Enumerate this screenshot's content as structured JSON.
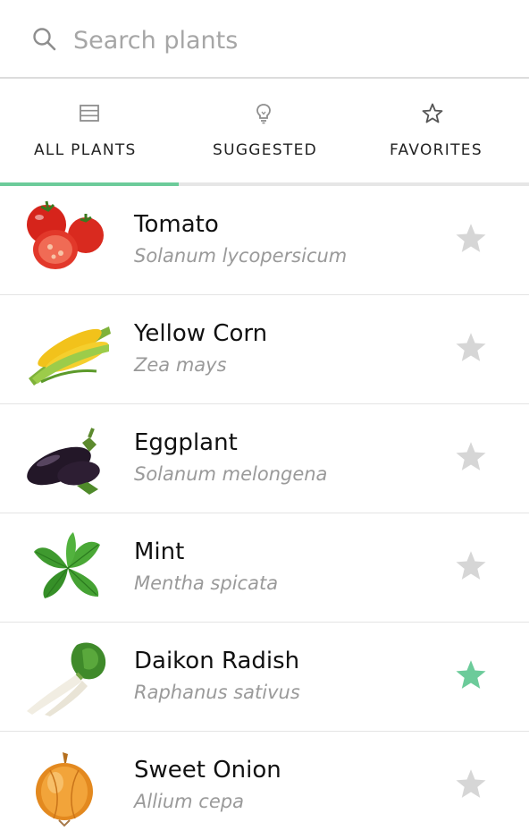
{
  "search": {
    "placeholder": "Search plants",
    "icon": "search-icon"
  },
  "tabs": [
    {
      "label": "ALL PLANTS",
      "icon": "list-icon",
      "active": true
    },
    {
      "label": "SUGGESTED",
      "icon": "lightbulb-icon",
      "active": false
    },
    {
      "label": "FAVORITES",
      "icon": "star-outline-icon",
      "active": false
    }
  ],
  "plants": [
    {
      "name": "Tomato",
      "scientific": "Solanum lycopersicum",
      "image": "tomato-image",
      "favorite": false
    },
    {
      "name": "Yellow Corn",
      "scientific": "Zea mays",
      "image": "corn-image",
      "favorite": false
    },
    {
      "name": "Eggplant",
      "scientific": "Solanum melongena",
      "image": "eggplant-image",
      "favorite": false
    },
    {
      "name": "Mint",
      "scientific": "Mentha spicata",
      "image": "mint-image",
      "favorite": false
    },
    {
      "name": "Daikon Radish",
      "scientific": "Raphanus sativus",
      "image": "daikon-image",
      "favorite": true
    },
    {
      "name": "Sweet Onion",
      "scientific": "Allium cepa",
      "image": "onion-image",
      "favorite": false
    }
  ],
  "colors": {
    "accent": "#6ccb9a",
    "favorite_on": "#6ccb9a",
    "favorite_off": "#d6d6d6",
    "icon_gray": "#8e8e8e"
  }
}
